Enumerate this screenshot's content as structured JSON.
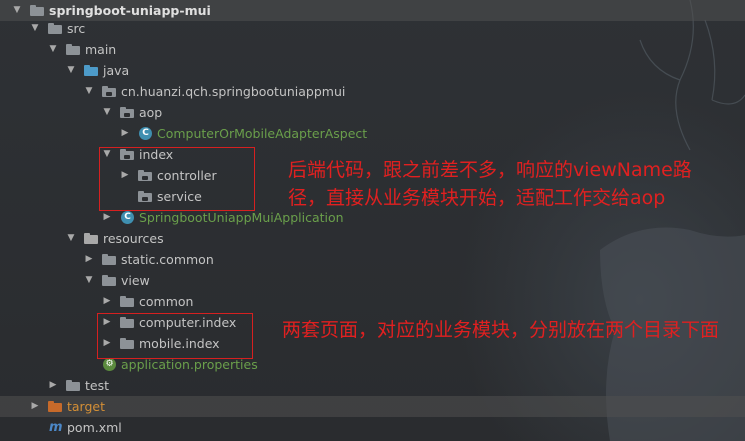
{
  "tree": {
    "project": "springboot-uniapp-mui",
    "src": "src",
    "main": "main",
    "java": "java",
    "package": "cn.huanzi.qch.springbootuniappmui",
    "aop": "aop",
    "aspect_class": "ComputerOrMobileAdapterAspect",
    "index": "index",
    "controller": "controller",
    "service": "service",
    "app_class": "SpringbootUniappMuiApplication",
    "resources": "resources",
    "static_common": "static.common",
    "view": "view",
    "common": "common",
    "computer_index": "computer.index",
    "mobile_index": "mobile.index",
    "app_properties": "application.properties",
    "test": "test",
    "target": "target",
    "pom": "pom.xml"
  },
  "icons": {
    "class_letter": "C",
    "maven_letter": "m"
  },
  "annotations": {
    "backend_note": "后端代码，跟之前差不多，响应的viewName路径，直接从业务模块开始，适配工作交给aop",
    "frontend_note": "两套页面，对应的业务模块，分别放在两个目录下面"
  },
  "colors": {
    "folder": "#8d9297",
    "source_folder": "#4d9bc9",
    "resource_folder": "#a8a8a8",
    "target_folder": "#c76a2a",
    "annotation": "#e02020"
  }
}
